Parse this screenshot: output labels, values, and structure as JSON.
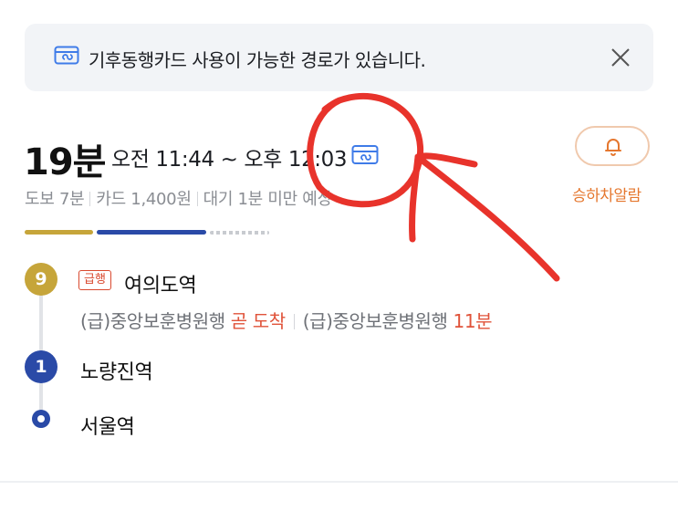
{
  "banner": {
    "icon": "card-icon",
    "text": "기후동행카드 사용이 가능한 경로가 있습니다.",
    "close_icon": "close-icon"
  },
  "route": {
    "duration": "19분",
    "time_range": "오전 11:44 ~ 오후 12:03",
    "card_icon": "card-icon",
    "summary": {
      "walk": "도보 7분",
      "fare": "카드 1,400원",
      "wait": "대기 1분 미만 예상"
    },
    "alarm_label": "승하차알람",
    "progress_colors": [
      "#c6a53a",
      "#2a4aa7",
      "#c8cbd0"
    ]
  },
  "segments": [
    {
      "line": "9",
      "line_color": "#c6a53a",
      "express_tag": "급행",
      "station": "여의도역",
      "arrivals": [
        {
          "train": "(급)중앙보훈병원행",
          "status": "곧 도착"
        },
        {
          "train": "(급)중앙보훈병원행",
          "status": "11분"
        }
      ]
    },
    {
      "line": "1",
      "line_color": "#2a4aa7",
      "station": "노량진역"
    },
    {
      "station": "서울역"
    }
  ],
  "accent_colors": {
    "alarm": "#e5772e",
    "status_red": "#e0533a",
    "annotation_red": "#e8332b"
  }
}
